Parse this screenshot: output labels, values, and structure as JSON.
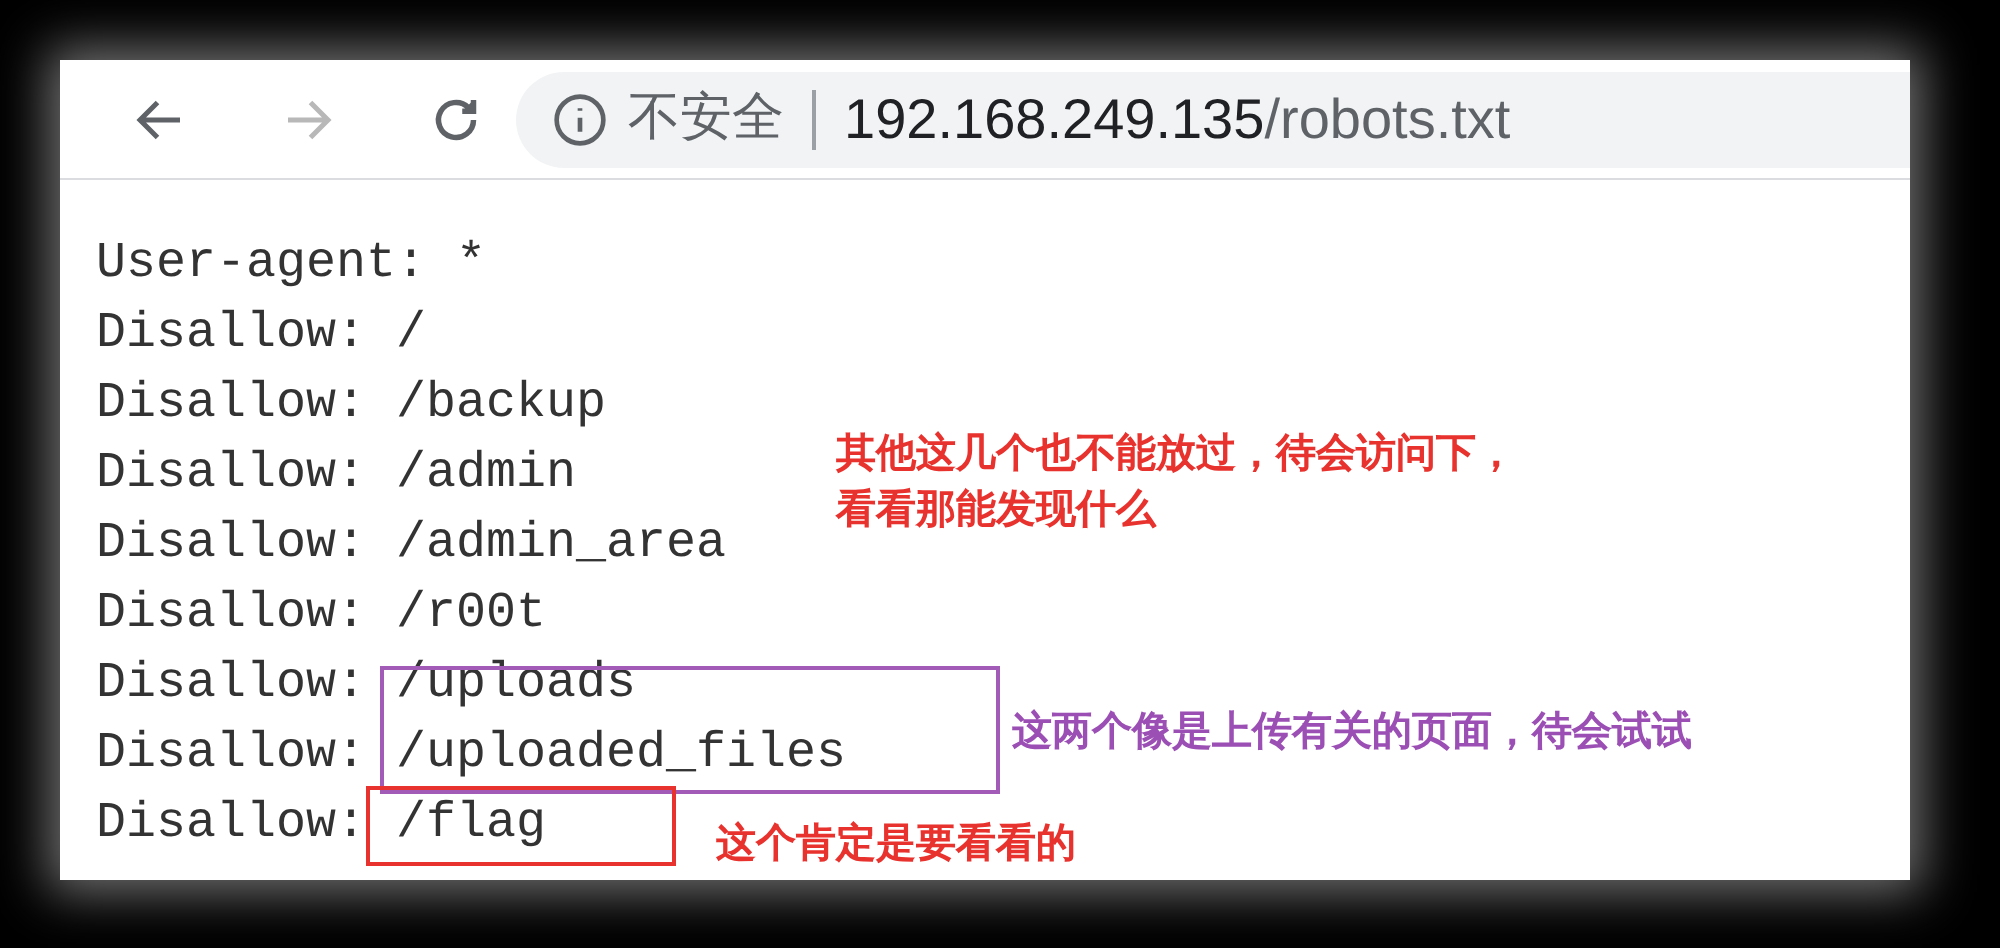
{
  "toolbar": {
    "buttons": [
      {
        "kind": "back",
        "disabled": false
      },
      {
        "kind": "forward",
        "disabled": true
      },
      {
        "kind": "reload",
        "disabled": false
      }
    ],
    "security": "不安全",
    "url_host": "192.168.249.135",
    "url_path": "/robots.txt"
  },
  "lines": [
    "User-agent: *",
    "Disallow: /",
    "Disallow: /backup",
    "Disallow: /admin",
    "Disallow: /admin_area",
    "Disallow: /r00t",
    "Disallow: /uploads",
    "Disallow: /uploaded_files",
    "Disallow: /flag"
  ],
  "annotations": [
    {
      "kind": "note",
      "color": "#e8322e",
      "lines": [
        "其他这几个也不能放过，待会访问下，",
        "看看那能发现什么"
      ]
    },
    {
      "kind": "box",
      "color": "#a35bb8"
    },
    {
      "kind": "note",
      "color": "#9b4fb5",
      "lines": [
        "这两个像是上传有关的页面，待会试试"
      ]
    },
    {
      "kind": "box",
      "color": "#e8322e"
    },
    {
      "kind": "note",
      "color": "#e8322e",
      "lines": [
        "这个肯定是要看看的"
      ]
    }
  ]
}
